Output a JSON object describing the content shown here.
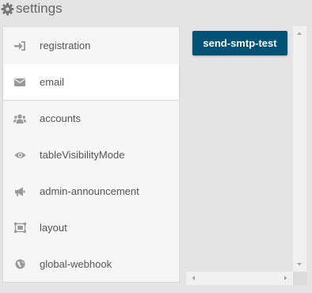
{
  "header": {
    "title": "settings",
    "icon": "gear-icon"
  },
  "sidebar": {
    "items": [
      {
        "label": "registration",
        "icon": "sign-in-icon"
      },
      {
        "label": "email",
        "icon": "envelope-icon",
        "active": true
      },
      {
        "label": "accounts",
        "icon": "users-icon"
      },
      {
        "label": "tableVisibilityMode",
        "icon": "eye-icon"
      },
      {
        "label": "admin-announcement",
        "icon": "bullhorn-icon"
      },
      {
        "label": "layout",
        "icon": "object-group-icon"
      },
      {
        "label": "global-webhook",
        "icon": "globe-icon"
      }
    ]
  },
  "content": {
    "button_label": "send-smtp-test"
  },
  "colors": {
    "accent": "#005377",
    "background": "#e4e4e4",
    "sidebar": "#f6f6f6",
    "icon": "#9a9a9a"
  }
}
